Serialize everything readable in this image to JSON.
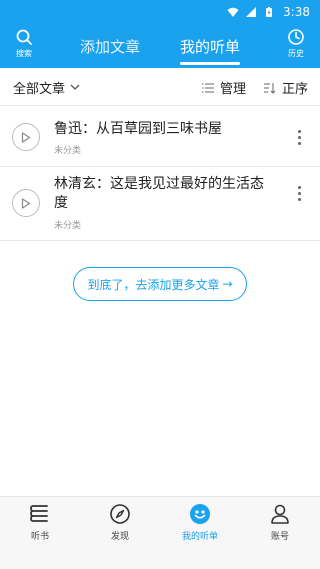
{
  "status": {
    "time": "3:38"
  },
  "header": {
    "search_label": "搜索",
    "history_label": "历史",
    "tabs": [
      {
        "label": "添加文章",
        "active": false
      },
      {
        "label": "我的听单",
        "active": true
      }
    ],
    "accent_color": "#1aa2ef"
  },
  "toolbar": {
    "filter_label": "全部文章",
    "manage_label": "管理",
    "order_label": "正序"
  },
  "articles": [
    {
      "title": "鲁迅：从百草园到三味书屋",
      "category": "未分类"
    },
    {
      "title": "林清玄：这是我见过最好的生活态度",
      "category": "未分类"
    }
  ],
  "end_button": {
    "label": "到底了，去添加更多文章",
    "arrow": "→"
  },
  "bottom_nav": [
    {
      "label": "听书",
      "icon": "book-icon",
      "active": false
    },
    {
      "label": "发现",
      "icon": "compass-icon",
      "active": false
    },
    {
      "label": "我的听单",
      "icon": "smile-icon",
      "active": true
    },
    {
      "label": "账号",
      "icon": "person-icon",
      "active": false
    }
  ]
}
